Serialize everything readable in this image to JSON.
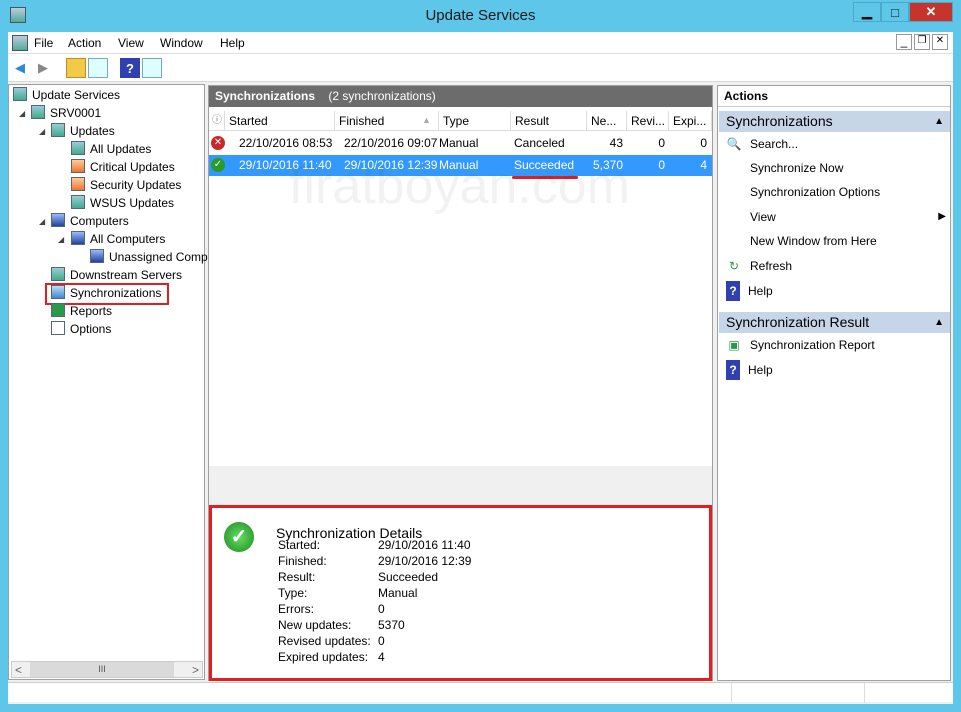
{
  "window": {
    "title": "Update Services",
    "min": "▁",
    "max": "□",
    "close": "✕"
  },
  "menu": [
    "File",
    "Action",
    "View",
    "Window",
    "Help"
  ],
  "mdi": {
    "min": "_",
    "restore": "❐",
    "close": "✕"
  },
  "tree": {
    "root": "Update Services",
    "server": "SRV0001",
    "updates": "Updates",
    "all_updates": "All Updates",
    "critical": "Critical Updates",
    "security": "Security Updates",
    "wsus": "WSUS Updates",
    "computers": "Computers",
    "all_computers": "All Computers",
    "unassigned": "Unassigned Computers",
    "downstream": "Downstream Servers",
    "synchronizations": "Synchronizations",
    "reports": "Reports",
    "options": "Options",
    "scroll_left": "<",
    "scroll_right": ">",
    "scroll_thumb": "III"
  },
  "list": {
    "title": "Synchronizations",
    "count": "(2 synchronizations)",
    "columns": [
      "Started",
      "Finished",
      "Type",
      "Result",
      "Ne...",
      "Revi...",
      "Expi..."
    ],
    "rows": [
      {
        "status": "error",
        "started": "22/10/2016 08:53",
        "finished": "22/10/2016 09:07",
        "type": "Manual",
        "result": "Canceled",
        "new": "43",
        "revised": "0",
        "expired": "0"
      },
      {
        "status": "success",
        "started": "29/10/2016 11:40",
        "finished": "29/10/2016 12:39",
        "type": "Manual",
        "result": "Succeeded",
        "new": "5,370",
        "revised": "0",
        "expired": "4"
      }
    ],
    "watermark": "firatboyan.com"
  },
  "details": {
    "title": "Synchronization Details",
    "fields": [
      {
        "label": "Started:",
        "value": "29/10/2016 11:40"
      },
      {
        "label": "Finished:",
        "value": "29/10/2016 12:39"
      },
      {
        "label": "Result:",
        "value": "Succeeded"
      },
      {
        "label": "Type:",
        "value": "Manual"
      },
      {
        "label": "Errors:",
        "value": "0"
      },
      {
        "label": "New updates:",
        "value": "5370"
      },
      {
        "label": "Revised updates:",
        "value": "0"
      },
      {
        "label": "Expired updates:",
        "value": "4"
      }
    ]
  },
  "actions": {
    "header": "Actions",
    "section1": "Synchronizations",
    "items1": [
      "Search...",
      "Synchronize Now",
      "Synchronization Options",
      "View",
      "New Window from Here",
      "Refresh",
      "Help"
    ],
    "section2": "Synchronization Result",
    "items2": [
      "Synchronization Report",
      "Help"
    ]
  },
  "colors": {
    "accent": "#3399ff",
    "highlight": "#e02020",
    "frame": "#5ec6e8"
  }
}
